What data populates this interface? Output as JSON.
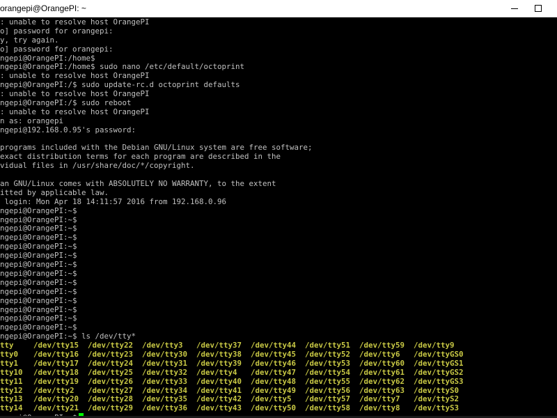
{
  "window": {
    "title": "orangepi@OrangePI: ~"
  },
  "colors": {
    "background": "#000000",
    "text": "#c0c0c0",
    "ls_entries": "#c8c844",
    "cursor": "#00ff00",
    "titlebar": "#ffffff"
  },
  "terminal": {
    "lines": [
      ": unable to resolve host OrangePI",
      "o] password for orangepi:",
      "y, try again.",
      "o] password for orangepi:",
      "ngepi@OrangePI:/home$",
      "ngepi@OrangePI:/home$ sudo nano /etc/default/octoprint",
      ": unable to resolve host OrangePI",
      "ngepi@OrangePI:/$ sudo update-rc.d octoprint defaults",
      ": unable to resolve host OrangePI",
      "ngepi@OrangePI:/$ sudo reboot",
      ": unable to resolve host OrangePI",
      "n as: orangepi",
      "ngepi@192.168.0.95's password:",
      "",
      "programs included with the Debian GNU/Linux system are free software;",
      "exact distribution terms for each program are described in the",
      "vidual files in /usr/share/doc/*/copyright.",
      "",
      "an GNU/Linux comes with ABSOLUTELY NO WARRANTY, to the extent",
      "itted by applicable law.",
      " login: Mon Apr 18 14:11:57 2016 from 192.168.0.96",
      "ngepi@OrangePI:~$",
      "ngepi@OrangePI:~$",
      "ngepi@OrangePI:~$",
      "ngepi@OrangePI:~$",
      "ngepi@OrangePI:~$",
      "ngepi@OrangePI:~$",
      "ngepi@OrangePI:~$",
      "ngepi@OrangePI:~$",
      "ngepi@OrangePI:~$",
      "ngepi@OrangePI:~$",
      "ngepi@OrangePI:~$",
      "ngepi@OrangePI:~$",
      "ngepi@OrangePI:~$",
      "ngepi@OrangePI:~$",
      "ngepi@OrangePI:~$ ls /dev/tty*"
    ],
    "ls_output": [
      [
        "tty",
        "/dev/tty15",
        "/dev/tty22",
        "/dev/tty3",
        "/dev/tty37",
        "/dev/tty44",
        "/dev/tty51",
        "/dev/tty59",
        "/dev/tty9"
      ],
      [
        "tty0",
        "/dev/tty16",
        "/dev/tty23",
        "/dev/tty30",
        "/dev/tty38",
        "/dev/tty45",
        "/dev/tty52",
        "/dev/tty6",
        "/dev/ttyGS0"
      ],
      [
        "tty1",
        "/dev/tty17",
        "/dev/tty24",
        "/dev/tty31",
        "/dev/tty39",
        "/dev/tty46",
        "/dev/tty53",
        "/dev/tty60",
        "/dev/ttyGS1"
      ],
      [
        "tty10",
        "/dev/tty18",
        "/dev/tty25",
        "/dev/tty32",
        "/dev/tty4",
        "/dev/tty47",
        "/dev/tty54",
        "/dev/tty61",
        "/dev/ttyGS2"
      ],
      [
        "tty11",
        "/dev/tty19",
        "/dev/tty26",
        "/dev/tty33",
        "/dev/tty40",
        "/dev/tty48",
        "/dev/tty55",
        "/dev/tty62",
        "/dev/ttyGS3"
      ],
      [
        "tty12",
        "/dev/tty2",
        "/dev/tty27",
        "/dev/tty34",
        "/dev/tty41",
        "/dev/tty49",
        "/dev/tty56",
        "/dev/tty63",
        "/dev/ttyS0"
      ],
      [
        "tty13",
        "/dev/tty20",
        "/dev/tty28",
        "/dev/tty35",
        "/dev/tty42",
        "/dev/tty5",
        "/dev/tty57",
        "/dev/tty7",
        "/dev/ttyS2"
      ],
      [
        "tty14",
        "/dev/tty21",
        "/dev/tty29",
        "/dev/tty36",
        "/dev/tty43",
        "/dev/tty50",
        "/dev/tty58",
        "/dev/tty8",
        "/dev/ttyS3"
      ]
    ],
    "final_prompt": "ngepi@OrangePI:~$"
  }
}
